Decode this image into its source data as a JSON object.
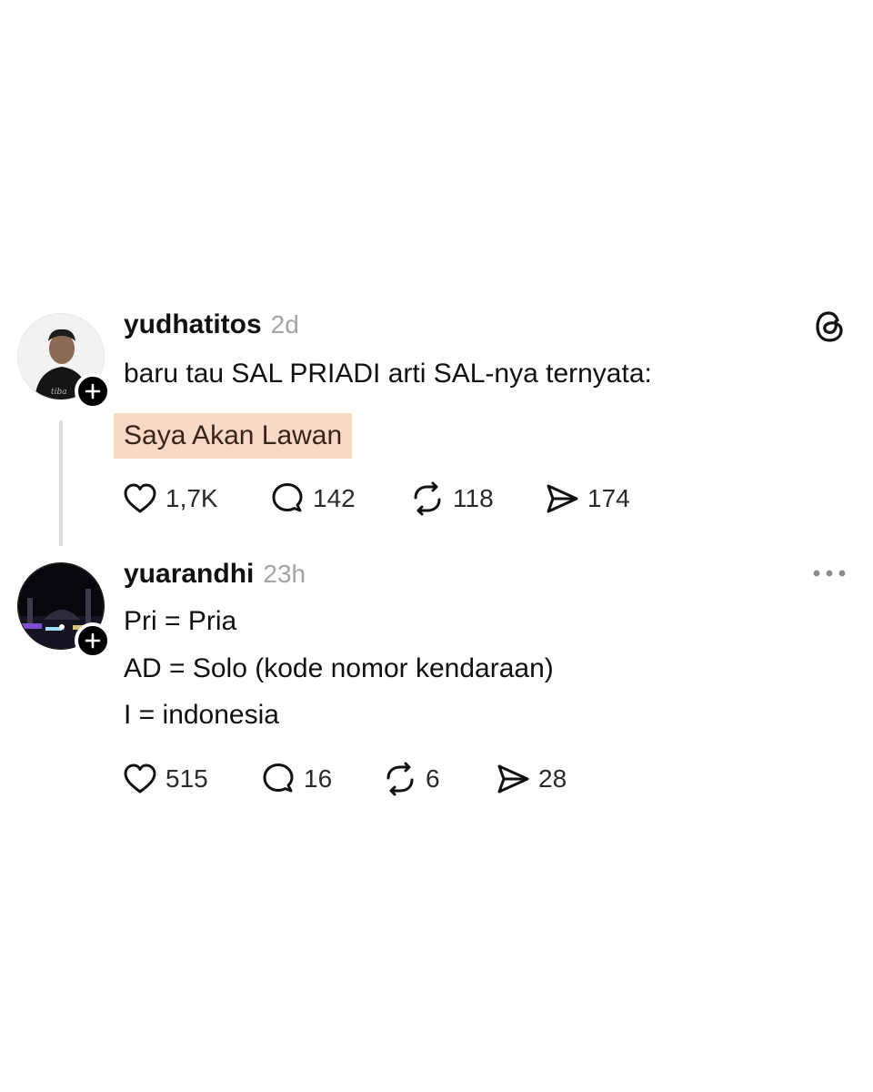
{
  "posts": [
    {
      "username": "yudhatitos",
      "time": "2d",
      "avatar_icon": "person-avatar",
      "lines": [
        "baru tau SAL PRIADI arti SAL-nya ternyata:"
      ],
      "highlight": "Saya Akan Lawan",
      "likes": "1,7K",
      "replies": "142",
      "reposts": "118",
      "shares": "174",
      "corner_icon": "threads-logo-icon"
    },
    {
      "username": "yuarandhi",
      "time": "23h",
      "avatar_icon": "night-city-avatar",
      "lines": [
        "Pri = Pria",
        "AD = Solo (kode nomor kendaraan)",
        "I = indonesia"
      ],
      "likes": "515",
      "replies": "16",
      "reposts": "6",
      "shares": "28",
      "corner_icon": "more-options-icon"
    }
  ],
  "colors": {
    "text": "#111111",
    "muted": "#a4a4a4",
    "highlight_bg": "#f9d9c5",
    "thread_line": "#dedede"
  }
}
